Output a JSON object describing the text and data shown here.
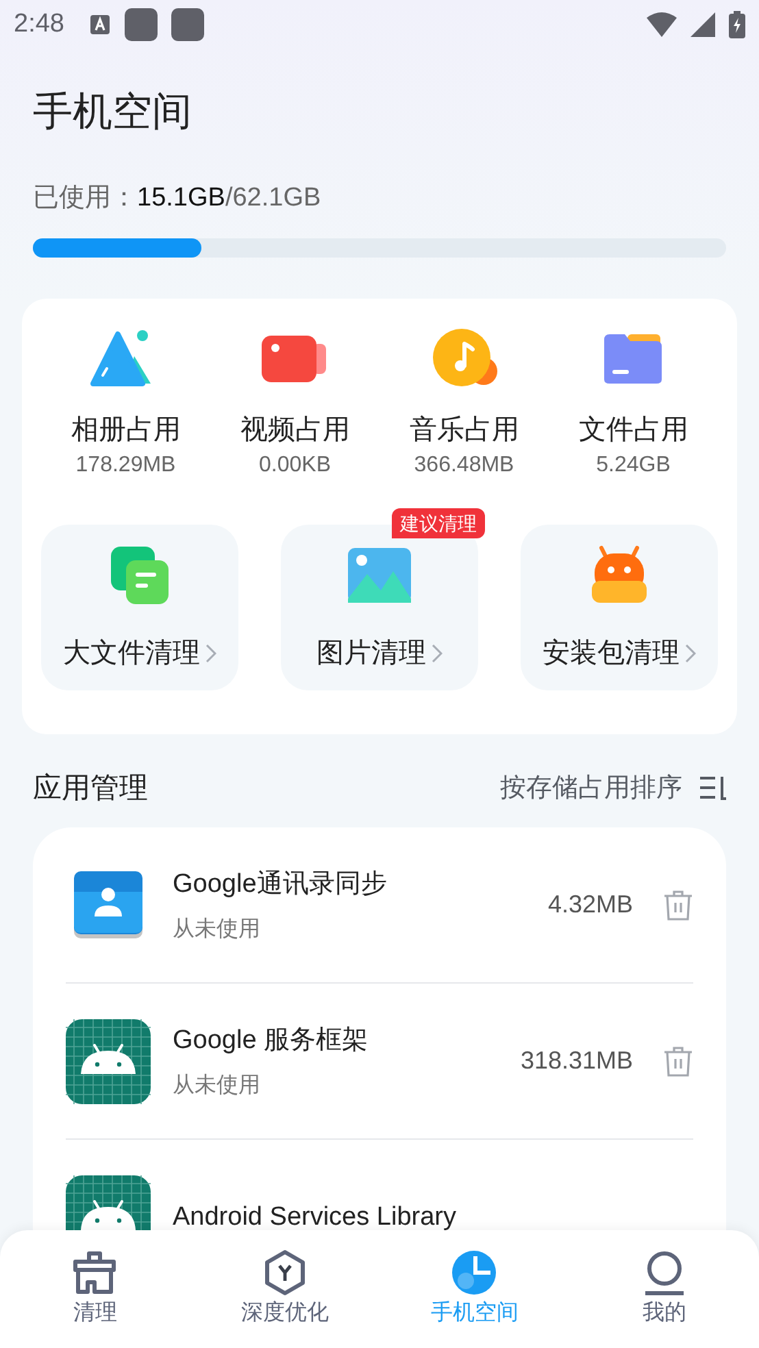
{
  "status_bar": {
    "time": "2:48"
  },
  "title": "手机空间",
  "usage": {
    "label": "已使用：",
    "used": "15.1GB",
    "total": "/62.1GB",
    "level": 0.243
  },
  "categories": [
    {
      "kind": "album",
      "label": "相册占用",
      "value": "178.29MB"
    },
    {
      "kind": "video",
      "label": "视频占用",
      "value": "0.00KB"
    },
    {
      "kind": "music",
      "label": "音乐占用",
      "value": "366.48MB"
    },
    {
      "kind": "file",
      "label": "文件占用",
      "value": "5.24GB"
    }
  ],
  "tools": [
    {
      "kind": "large-file",
      "label": "大文件清理"
    },
    {
      "kind": "picture",
      "label": "图片清理",
      "badge": "建议清理"
    },
    {
      "kind": "apk",
      "label": "安装包清理"
    }
  ],
  "apps_section": {
    "title": "应用管理",
    "sort": "按存储占用排序"
  },
  "apps": [
    {
      "kind": "contacts",
      "name": "Google通讯录同步",
      "status": "从未使用",
      "size": "4.32MB"
    },
    {
      "kind": "android",
      "name": "Google 服务框架",
      "status": "从未使用",
      "size": "318.31MB"
    },
    {
      "kind": "android",
      "name": "Android Services Library"
    }
  ],
  "nav": [
    {
      "kind": "clean",
      "label": "清理",
      "selected": false
    },
    {
      "kind": "optimize",
      "label": "深度优化",
      "selected": false
    },
    {
      "kind": "space",
      "label": "手机空间",
      "selected": true
    },
    {
      "kind": "profile",
      "label": "我的",
      "selected": false
    }
  ]
}
